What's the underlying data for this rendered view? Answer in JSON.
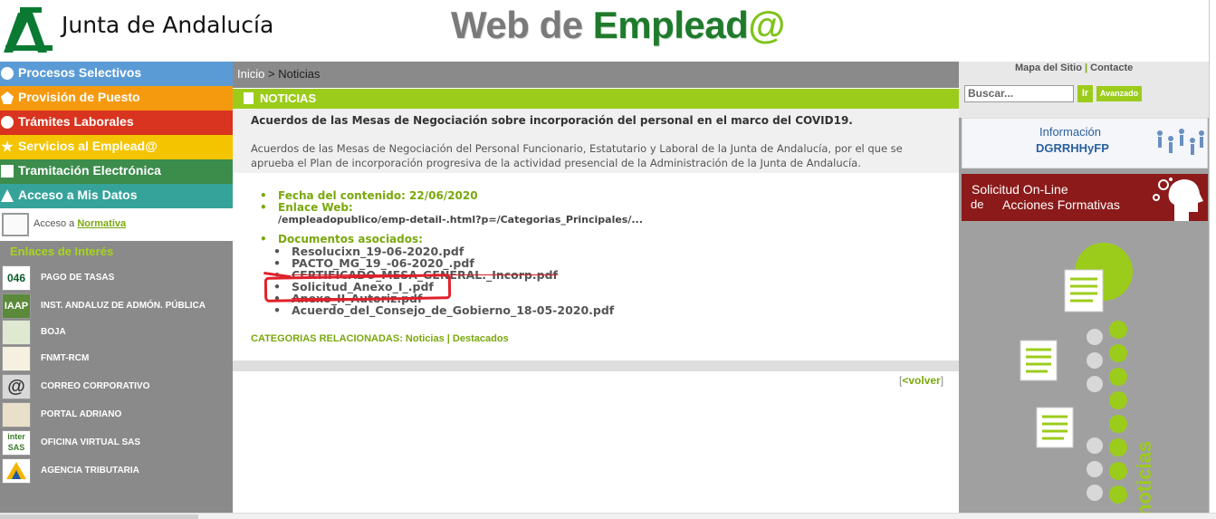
{
  "header": {
    "org_name": "Junta de Andalucía",
    "site_title_part1": "Web de ",
    "site_title_part2": "Emplead",
    "site_title_at": "@"
  },
  "menu": [
    {
      "label": "Procesos Selectivos",
      "color": "#5b9bd5"
    },
    {
      "label": "Provisión de Puesto",
      "color": "#f59a0f"
    },
    {
      "label": "Trámites Laborales",
      "color": "#d8341f"
    },
    {
      "label": "Servicios al Emplead@",
      "color": "#f5c400"
    },
    {
      "label": "Tramitación Electrónica",
      "color": "#3c8c4c"
    },
    {
      "label": "Acceso a Mis Datos",
      "color": "#35a39a"
    }
  ],
  "normativa": {
    "prefix": "Acceso a ",
    "link": "Normativa"
  },
  "enlaces": {
    "title": "Enlaces de Interés",
    "items": [
      {
        "label": "PAGO DE TASAS",
        "icon": "046"
      },
      {
        "label": "INST. ANDALUZ DE ADMÓN. PÚBLICA",
        "icon": "IAAP"
      },
      {
        "label": "BOJA",
        "icon": "boja-icon"
      },
      {
        "label": "FNMT-RCM",
        "icon": "fnmt-icon"
      },
      {
        "label": "CORREO CORPORATIVO",
        "icon": "@"
      },
      {
        "label": "PORTAL ADRIANO",
        "icon": "adriano-icon"
      },
      {
        "label": "OFICINA VIRTUAL SAS",
        "icon": "inter SAS"
      },
      {
        "label": "AGENCIA TRIBUTARIA",
        "icon": "aeat-icon"
      }
    ]
  },
  "breadcrumb": {
    "home": "Inicio",
    "sep": ">",
    "current": "Noticias"
  },
  "section_title": "NOTICIAS",
  "news": {
    "title": "Acuerdos de las Mesas de Negociación sobre incorporación del personal en el marco del COVID19.",
    "body": "Acuerdos de las Mesas de Negociación del Personal Funcionario, Estatutario y Laboral de la Junta de Andalucía, por el que se aprueba el Plan de incorporación progresiva de la actividad presencial de la Administración de la Junta de Andalucía."
  },
  "details": {
    "date_label": "Fecha del contenido: 22/06/2020",
    "web_label": "Enlace Web:",
    "web_url": "/empleadopublico/emp-detail-.html?p=/Categorias_Principales/...",
    "docs_label": "Documentos asociados:",
    "docs": [
      "Resolucixn_19-06-2020.pdf",
      "PACTO_MG_19_-06-2020_.pdf",
      "CERTIFICADO_MESA_GENERAL._Incorp.pdf",
      "Solicitud_Anexo_I_.pdf",
      "Anexo_II_Autoriz.pdf",
      "Acuerdo_del_Consejo_de_Gobierno_18-05-2020.pdf"
    ]
  },
  "categories": {
    "label": "CATEGORIAS RELACIONADAS:",
    "items": [
      "Noticias",
      "Destacados"
    ],
    "sep": "|"
  },
  "volver": {
    "open": "[",
    "link": "<volver",
    "close": "]"
  },
  "right": {
    "link1": "Mapa del Sitio",
    "sep": "|",
    "link2": "Contacte",
    "search_placeholder": "Buscar...",
    "search_btn": "Ir",
    "adv_btn": "Avanzado",
    "info_line1": "Información",
    "info_line2": "DGRRHHyFP",
    "form_line1": "Solicitud On-Line",
    "form_line2": "de",
    "form_line3": "Acciones Formativas",
    "noticias_label": "noticias"
  },
  "colors": {
    "accent_green": "#9ccc1b",
    "link_green": "#7aa80c",
    "sidebar_grey": "#8a8a8a",
    "annotation_red": "#e0202a"
  }
}
